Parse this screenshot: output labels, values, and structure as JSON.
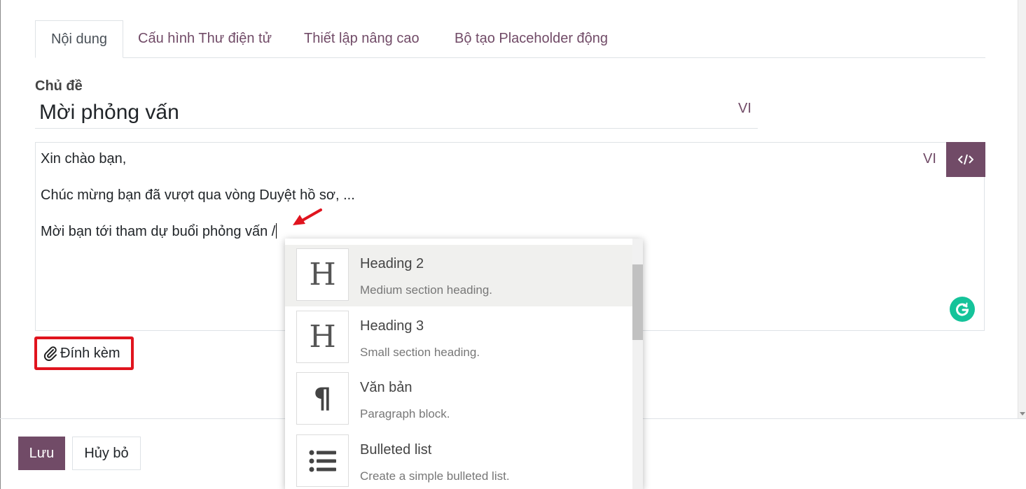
{
  "tabs": [
    {
      "label": "Nội dung"
    },
    {
      "label": "Cấu hình Thư điện tử"
    },
    {
      "label": "Thiết lập nâng cao"
    },
    {
      "label": "Bộ tạo Placeholder động"
    }
  ],
  "subject": {
    "label": "Chủ đề",
    "value": "Mời phỏng vấn",
    "lang": "VI"
  },
  "editor": {
    "lang": "VI",
    "lines": [
      "Xin chào bạn,",
      "Chúc mừng bạn đã vượt qua vòng Duyệt hồ sơ, ...",
      "Mời bạn tới tham dự buổi phỏng vấn /"
    ],
    "code_view_icon": "code-icon",
    "grammarly_icon": "grammarly-icon"
  },
  "attach": {
    "label": "Đính kèm",
    "icon": "paperclip-icon"
  },
  "footer": {
    "save_label": "Lưu",
    "cancel_label": "Hủy bỏ"
  },
  "powerbox": {
    "items": [
      {
        "title": "Heading 2",
        "description": "Medium section heading.",
        "icon": "heading-icon"
      },
      {
        "title": "Heading 3",
        "description": "Small section heading.",
        "icon": "heading-icon"
      },
      {
        "title": "Văn bản",
        "description": "Paragraph block.",
        "icon": "paragraph-icon"
      },
      {
        "title": "Bulleted list",
        "description": "Create a simple bulleted list.",
        "icon": "bulleted-list-icon"
      }
    ]
  },
  "colors": {
    "primary": "#714B67",
    "highlight_border": "#e0141e",
    "grammarly": "#15c39a",
    "annotation_arrow": "#e0141e"
  }
}
